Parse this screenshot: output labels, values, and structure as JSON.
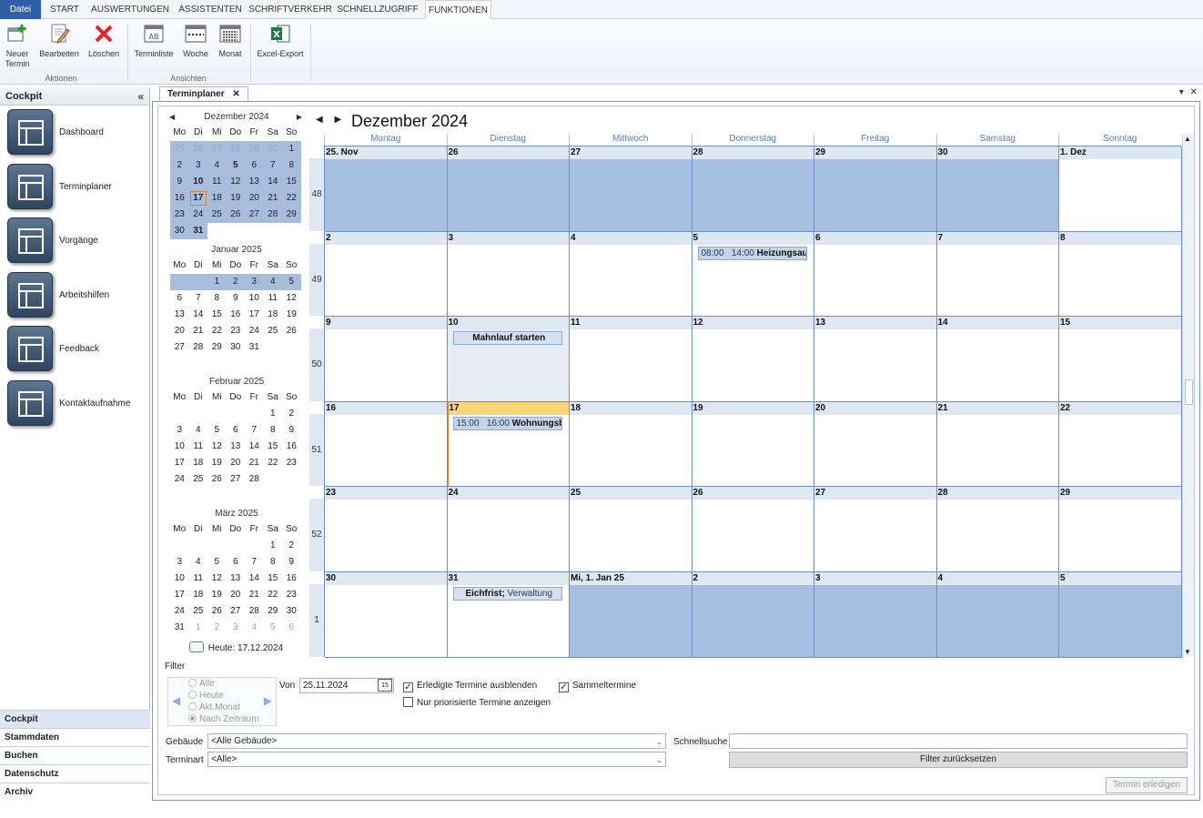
{
  "ribbon_tabs": [
    {
      "label": "Datei"
    },
    {
      "label": "START"
    },
    {
      "label": "AUSWERTUNGEN"
    },
    {
      "label": "ASSISTENTEN"
    },
    {
      "label": "SCHRIFTVERKEHR"
    },
    {
      "label": "SCHNELLZUGRIFF"
    },
    {
      "label": "FUNKTIONEN"
    }
  ],
  "ribbon": {
    "aktionen": {
      "label": "Aktionen",
      "new_line1": "Neuer",
      "new_line2": "Termin",
      "edit": "Bearbeiten",
      "delete": "Löschen"
    },
    "ansichten": {
      "label": "Ansichten",
      "list": "Terminliste",
      "week": "Woche",
      "month": "Monat"
    },
    "excel": "Excel-Export"
  },
  "cockpit": {
    "title": "Cockpit",
    "collapse": "«",
    "items": [
      {
        "label": "Dashboard",
        "icon": "dashboard-icon"
      },
      {
        "label": "Terminplaner",
        "icon": "calendar-icon"
      },
      {
        "label": "Vorgänge",
        "icon": "workflow-icon"
      },
      {
        "label": "Arbeitshilfen",
        "icon": "tools-icon"
      },
      {
        "label": "Feedback",
        "icon": "feedback-icon"
      },
      {
        "label": "Kontaktaufnahme",
        "icon": "phone-icon"
      }
    ],
    "bottom_tabs": [
      "Cockpit",
      "Stammdaten",
      "Buchen",
      "Datenschutz",
      "Archiv"
    ]
  },
  "document_tab": {
    "label": "Terminplaner",
    "close": "✕"
  },
  "weekday_short": [
    "Mo",
    "Di",
    "Mi",
    "Do",
    "Fr",
    "Sa",
    "So"
  ],
  "mini_calendars": [
    {
      "title": "Dezember 2024",
      "nav": true,
      "days": [
        "25",
        "26",
        "27",
        "28",
        "29",
        "30",
        "1",
        "2",
        "3",
        "4",
        "5",
        "6",
        "7",
        "8",
        "9",
        "10",
        "11",
        "12",
        "13",
        "14",
        "15",
        "16",
        "17",
        "18",
        "19",
        "20",
        "21",
        "22",
        "23",
        "24",
        "25",
        "26",
        "27",
        "28",
        "29",
        "30",
        "31"
      ],
      "offset": 0,
      "dim_first": 6,
      "dim_last": 0,
      "selected_all": true,
      "bold": [
        "5",
        "10",
        "17",
        "31"
      ],
      "today": "17"
    },
    {
      "title": "Januar 2025",
      "nav": false,
      "days": [
        "1",
        "2",
        "3",
        "4",
        "5",
        "6",
        "7",
        "8",
        "9",
        "10",
        "11",
        "12",
        "13",
        "14",
        "15",
        "16",
        "17",
        "18",
        "19",
        "20",
        "21",
        "22",
        "23",
        "24",
        "25",
        "26",
        "27",
        "28",
        "29",
        "30",
        "31"
      ],
      "offset": 2,
      "selected_first_row": true
    },
    {
      "title": "Februar 2025",
      "nav": false,
      "days": [
        "1",
        "2",
        "3",
        "4",
        "5",
        "6",
        "7",
        "8",
        "9",
        "10",
        "11",
        "12",
        "13",
        "14",
        "15",
        "16",
        "17",
        "18",
        "19",
        "20",
        "21",
        "22",
        "23",
        "24",
        "25",
        "26",
        "27",
        "28"
      ],
      "offset": 5
    },
    {
      "title": "März 2025",
      "nav": false,
      "days": [
        "1",
        "2",
        "3",
        "4",
        "5",
        "6",
        "7",
        "8",
        "9",
        "10",
        "11",
        "12",
        "13",
        "14",
        "15",
        "16",
        "17",
        "18",
        "19",
        "20",
        "21",
        "22",
        "23",
        "24",
        "25",
        "26",
        "27",
        "28",
        "29",
        "30",
        "31",
        "1",
        "2",
        "3",
        "4",
        "5",
        "6"
      ],
      "offset": 5,
      "dim_trailing": 6
    }
  ],
  "today_label": "Heute: 17.12.2024",
  "month_view": {
    "title": "Dezember 2024",
    "days": [
      "Montag",
      "Dienstag",
      "Mittwoch",
      "Donnerstag",
      "Freitag",
      "Samstag",
      "Sonntag"
    ],
    "weeks": [
      {
        "num": "48",
        "cells": [
          "25. Nov",
          "26",
          "27",
          "28",
          "29",
          "30",
          "1. Dez"
        ],
        "other": [
          0,
          1,
          2,
          3,
          4,
          5
        ]
      },
      {
        "num": "49",
        "cells": [
          "2",
          "3",
          "4",
          "5",
          "6",
          "7",
          "8"
        ],
        "other": []
      },
      {
        "num": "50",
        "cells": [
          "9",
          "10",
          "11",
          "12",
          "13",
          "14",
          "15"
        ],
        "other": [],
        "cur": [
          1
        ]
      },
      {
        "num": "51",
        "cells": [
          "16",
          "17",
          "18",
          "19",
          "20",
          "21",
          "22"
        ],
        "other": [],
        "today": 1
      },
      {
        "num": "52",
        "cells": [
          "23",
          "24",
          "25",
          "26",
          "27",
          "28",
          "29"
        ],
        "other": []
      },
      {
        "num": "1",
        "cells": [
          "30",
          "31",
          "Mi, 1. Jan 25",
          "2",
          "3",
          "4",
          "5"
        ],
        "other": [
          2,
          3,
          4,
          5,
          6
        ]
      }
    ],
    "appointments": [
      {
        "week": 1,
        "day": 3,
        "time": "08:00   14:00",
        "title": "Heizungsaus"
      },
      {
        "week": 2,
        "day": 1,
        "allday": true,
        "title": "Mahnlauf starten"
      },
      {
        "week": 3,
        "day": 1,
        "time": "15:00   16:00",
        "title": "Wohnungsb"
      },
      {
        "week": 5,
        "day": 1,
        "allday": true,
        "title": "Eichfrist;",
        "sub": " Verwaltung"
      }
    ]
  },
  "filter": {
    "title": "Filter",
    "radios": [
      {
        "label": "Alle",
        "on": false
      },
      {
        "label": "Heute",
        "on": false
      },
      {
        "label": "Akt.Monat",
        "on": false
      },
      {
        "label": "Nach Zeitraum",
        "on": true
      }
    ],
    "von_label": "Von",
    "von_value": "25.11.2024",
    "date_icon": "15",
    "hide_done": "Erledigte Termine ausblenden",
    "priority_only": "Nur priorisierte Termine anzeigen",
    "collective": "Sammeltermine",
    "building_label": "Gebäude",
    "building_value": "<Alle Gebäude>",
    "type_label": "Terminart",
    "type_value": "<Alle>",
    "quicksearch_label": "Schnellsuche",
    "reset": "Filter zurücksetzen",
    "done_button": "Termin erledigen"
  }
}
